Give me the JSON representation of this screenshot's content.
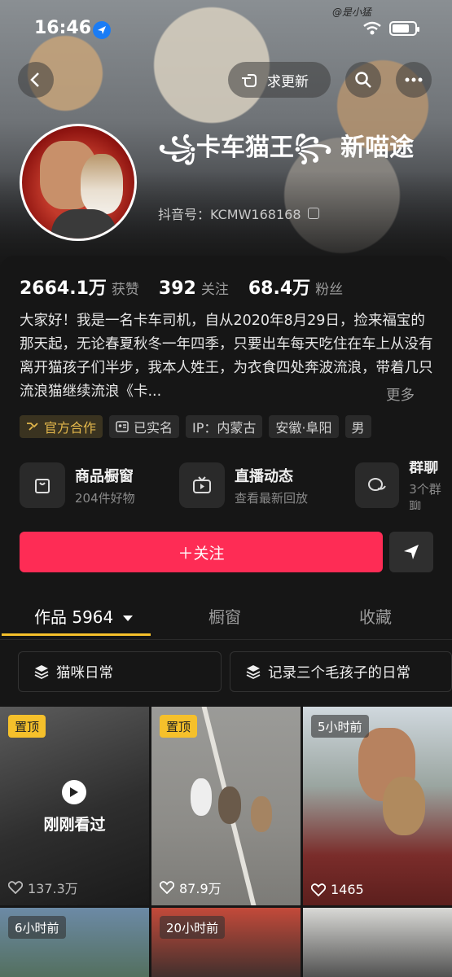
{
  "status": {
    "time": "16:46",
    "watermark": "@是小猛"
  },
  "nav": {
    "update_label": "求更新"
  },
  "profile": {
    "nickname": "꧁卡车猫王꧂ 新喵途",
    "account": "抖音号：KCMW168168",
    "stats": [
      {
        "num": "2664.1万",
        "label": "获赞"
      },
      {
        "num": "392",
        "label": "关注"
      },
      {
        "num": "68.4万",
        "label": "粉丝"
      }
    ],
    "bio": "大家好！我是一名卡车司机，自从2020年8月29日，捡来福宝的那天起，无论春夏秋冬一年四季，只要出车每天吃住在车上从没有离开猫孩子们半步，我本人姓王，为衣食四处奔波流浪，带着几只流浪猫继续流浪《卡...",
    "bio_more": "更多",
    "tags": [
      "官方合作",
      "已实名",
      "IP：内蒙古",
      "安徽·阜阳",
      "男"
    ]
  },
  "shortcuts": [
    {
      "title": "商品橱窗",
      "sub": "204件好物",
      "icon": "shopping-bag-icon"
    },
    {
      "title": "直播动态",
      "sub": "查看最新回放",
      "icon": "tv-icon"
    },
    {
      "title": "群聊",
      "sub": "3个群聊",
      "icon": "chat-icon"
    }
  ],
  "actions": {
    "follow": "＋关注"
  },
  "tabs": [
    {
      "label": "作品 5964",
      "active": true
    },
    {
      "label": "橱窗",
      "active": false
    },
    {
      "label": "收藏",
      "active": false
    }
  ],
  "collections": [
    {
      "label": "猫咪日常"
    },
    {
      "label": "记录三个毛孩子的日常"
    }
  ],
  "videos": [
    {
      "badge": "置顶",
      "watched": "刚刚看过",
      "likes": "137.3万"
    },
    {
      "badge": "置顶",
      "likes": "87.9万"
    },
    {
      "badge": "5小时前",
      "likes": "1465"
    },
    {
      "badge": "6小时前"
    },
    {
      "badge": "20小时前"
    },
    {
      "badge": ""
    }
  ],
  "colors": {
    "accent": "#fe2c55",
    "pin": "#f5c02b",
    "bg": "#161616"
  }
}
